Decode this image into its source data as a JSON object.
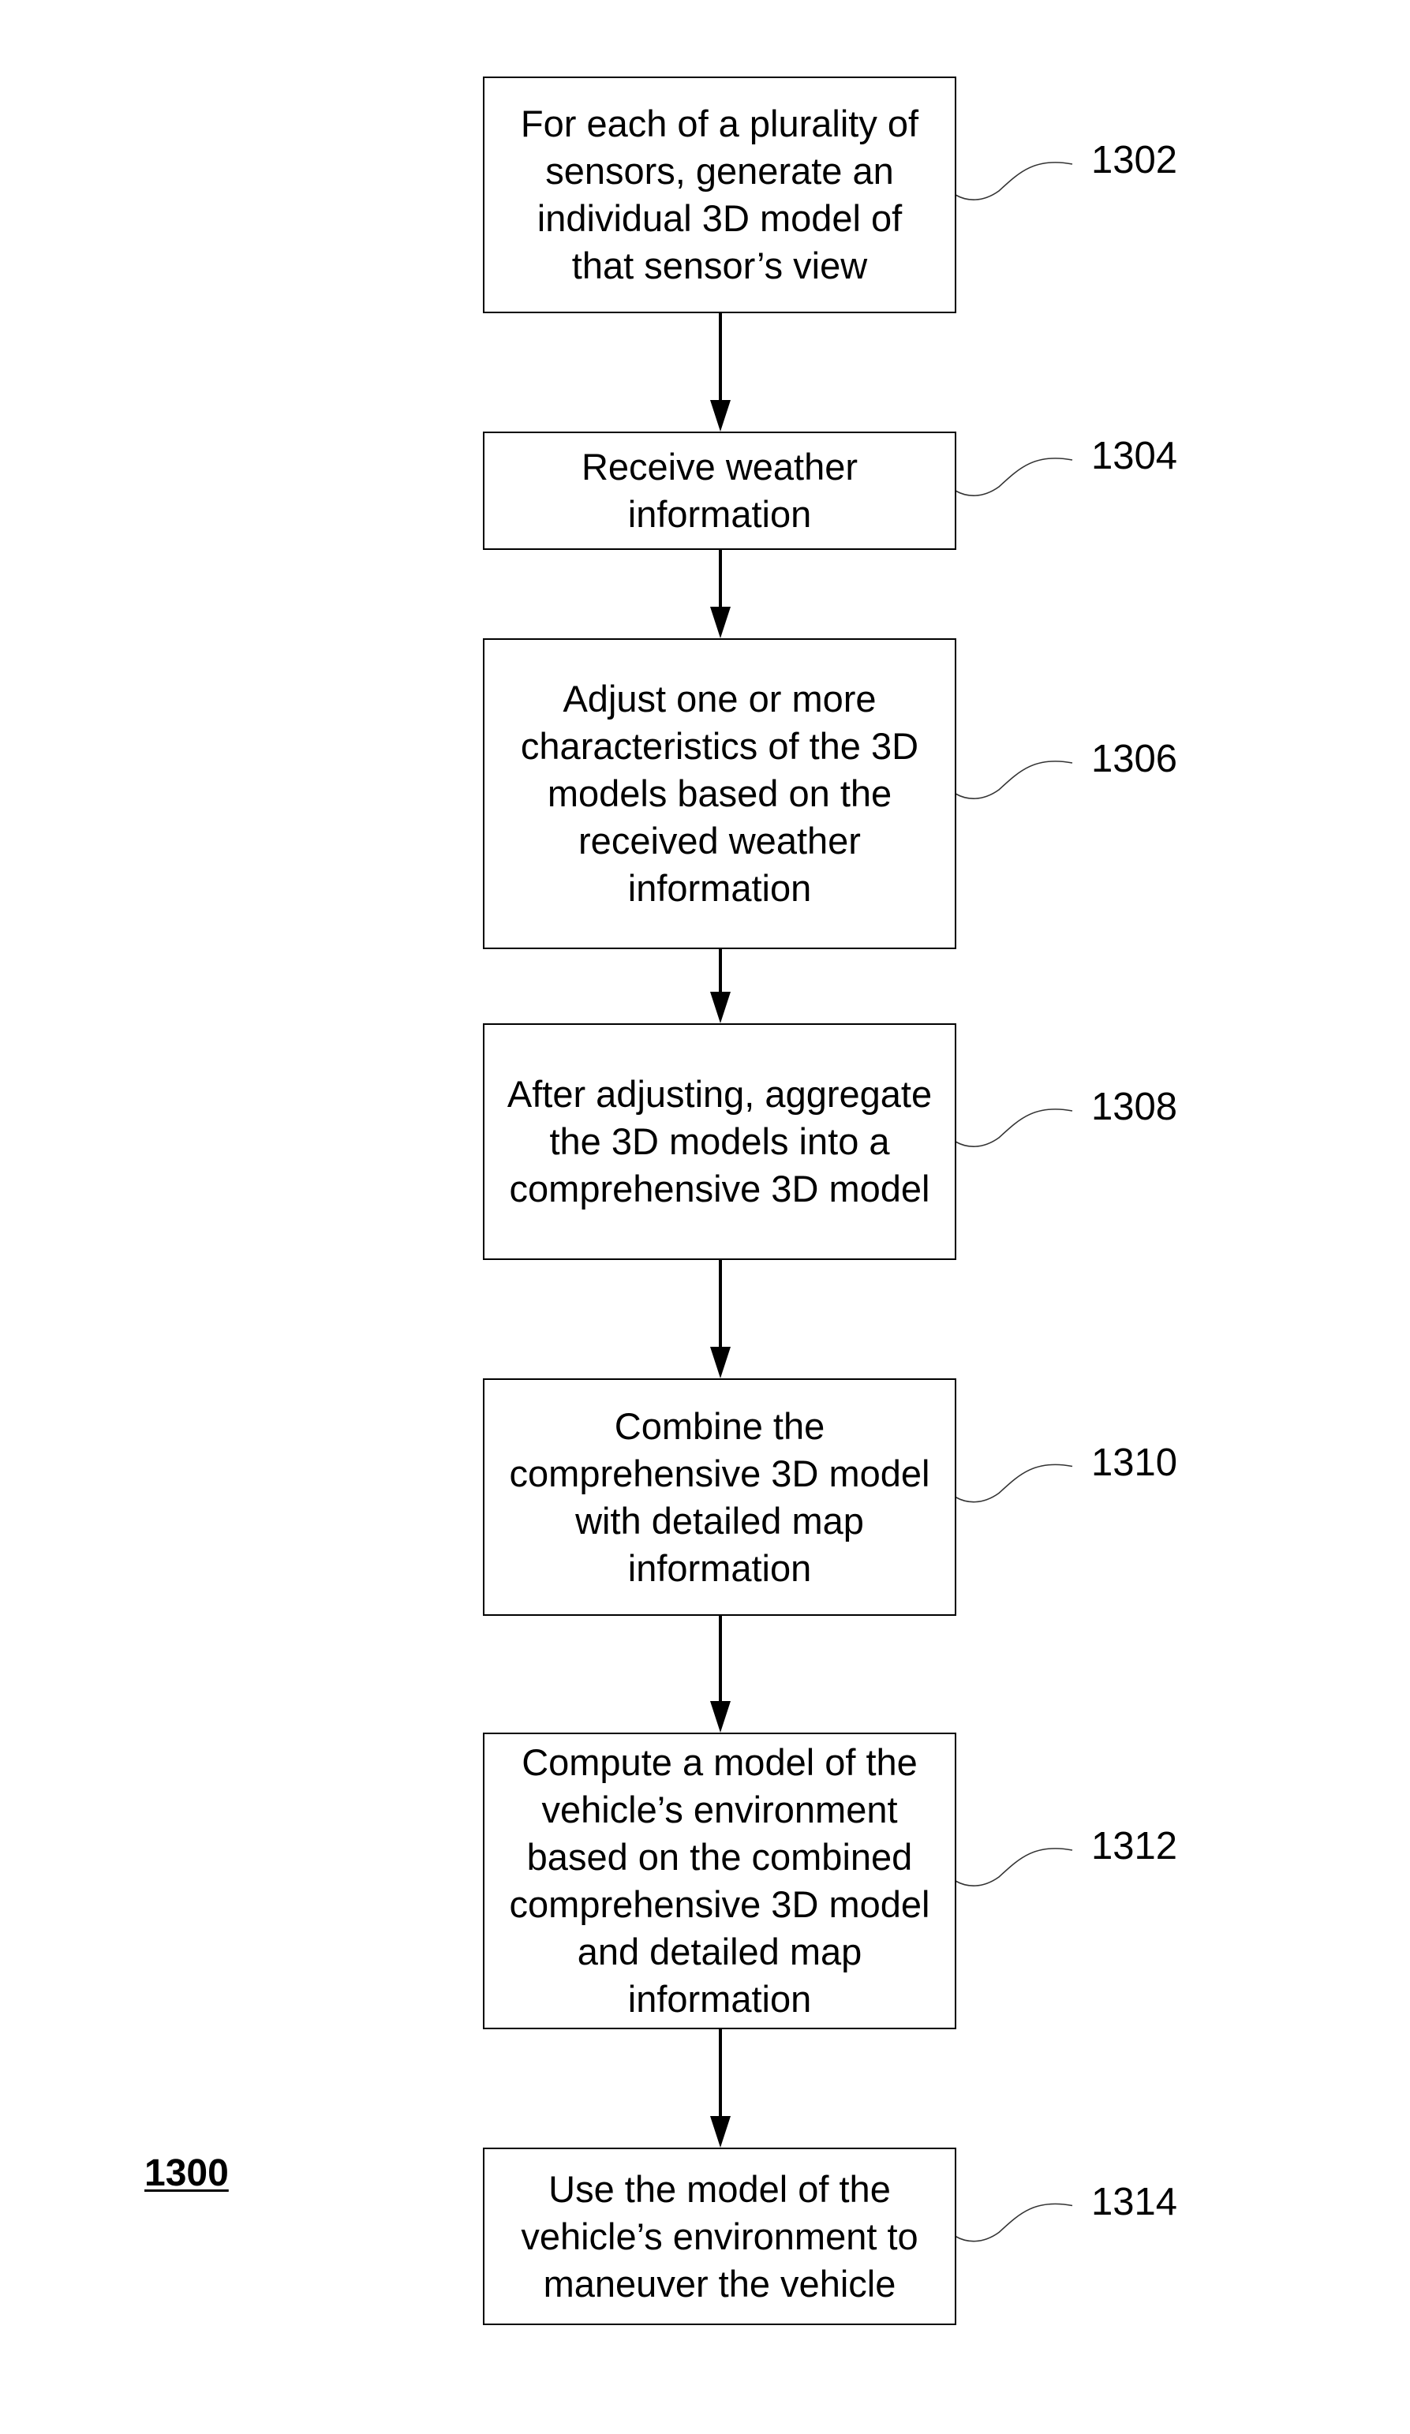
{
  "figure": {
    "label": "1300"
  },
  "steps": [
    {
      "ref": "1302",
      "lines": [
        "For each of a plurality of",
        "sensors, generate an",
        "individual 3D model of",
        "that sensor’s view"
      ]
    },
    {
      "ref": "1304",
      "lines": [
        "Receive weather",
        "information"
      ]
    },
    {
      "ref": "1306",
      "lines": [
        "Adjust one or more",
        "characteristics of the 3D",
        "models based on the",
        "received weather",
        "information"
      ]
    },
    {
      "ref": "1308",
      "lines": [
        "After adjusting, aggregate",
        "the 3D models into a",
        "comprehensive 3D model"
      ]
    },
    {
      "ref": "1310",
      "lines": [
        "Combine the",
        "comprehensive 3D model",
        "with detailed map",
        "information"
      ]
    },
    {
      "ref": "1312",
      "lines": [
        "Compute a model of the",
        "vehicle’s environment",
        "based on the combined",
        "comprehensive 3D model",
        "and detailed map",
        "information"
      ]
    },
    {
      "ref": "1314",
      "lines": [
        "Use the model of the",
        "vehicle’s environment to",
        "maneuver the vehicle"
      ]
    }
  ],
  "colors": {
    "stroke": "#000000",
    "leader": "#333333",
    "background": "#ffffff"
  }
}
